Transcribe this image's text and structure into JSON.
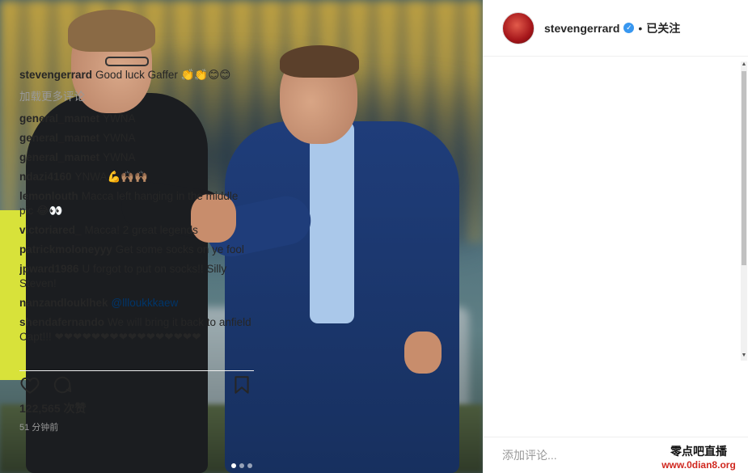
{
  "post": {
    "image_alt_subject": "",
    "carousel": {
      "count": 3,
      "active_index": 0
    }
  },
  "header": {
    "username": "stevengerrard",
    "verified_glyph": "✓",
    "separator": "•",
    "follow_label": "已关注"
  },
  "caption": {
    "username": "stevengerrard",
    "text": "Good luck Gaffer 👏👏😊😊"
  },
  "load_more_label": "加载更多评论",
  "comments": [
    {
      "username": "general_mamet",
      "text": "YWNA"
    },
    {
      "username": "general_mamet",
      "text": "YWNA"
    },
    {
      "username": "general_mamet",
      "text": "YWNA"
    },
    {
      "username": "ndazi4160",
      "text": "YNWA💪🙌🏽🙌🏽"
    },
    {
      "username": "lemonlouth",
      "text": "Macca left hanging in the middle pic 😂👀"
    },
    {
      "username": "victoriared_",
      "text": "Macca! 2 great legends"
    },
    {
      "username": "patrickmoloneyyy",
      "text": "Get some socks on ye fool"
    },
    {
      "username": "jpward1986",
      "text": "U forgot to put on socks!! Silly Steven!"
    },
    {
      "username": "nanzandlouklhek",
      "mention": "@llloukkkaew"
    },
    {
      "username": "shendafernando",
      "text": "We will bring it back to anfield Capt!!! ❤❤❤❤❤❤❤❤❤❤❤❤❤❤❤❤"
    }
  ],
  "actions": {
    "like_icon": "heart-icon",
    "comment_icon": "comment-bubble-icon",
    "save_icon": "bookmark-icon"
  },
  "likes_label": "122,565 次赞",
  "timestamp": "51 分钟前",
  "add_comment_placeholder": "添加评论...",
  "watermark": {
    "title": "零点吧直播",
    "url": "www.0dian8.org"
  },
  "colors": {
    "verified": "#3897f0",
    "watermark_url": "#d0281f",
    "secondary_text": "#999999"
  }
}
